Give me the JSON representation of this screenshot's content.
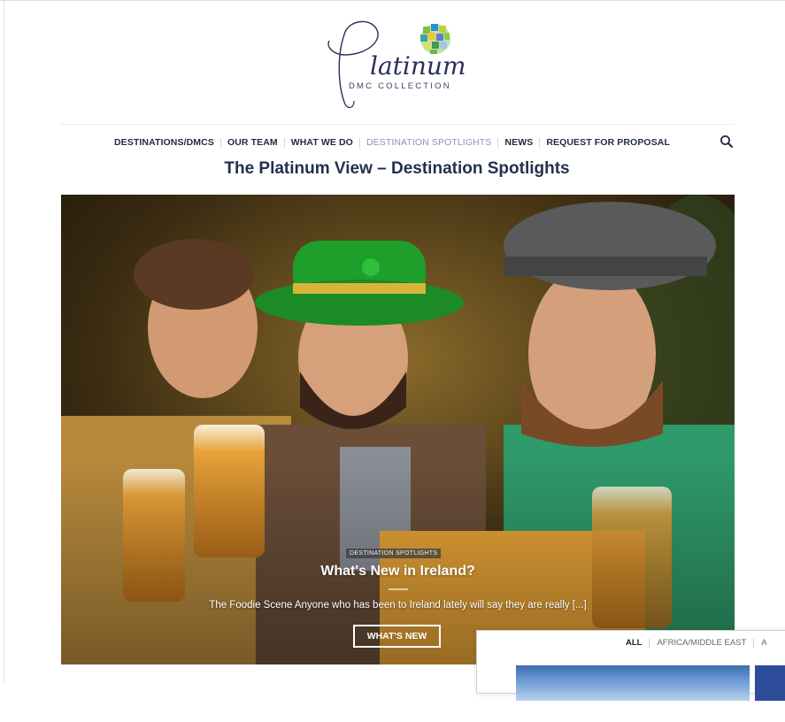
{
  "logo": {
    "name": "Platinum",
    "sub": "DMC COLLECTION"
  },
  "nav": {
    "items": [
      {
        "label": "DESTINATIONS/DMCS"
      },
      {
        "label": "OUR TEAM"
      },
      {
        "label": "WHAT WE DO"
      },
      {
        "label": "DESTINATION SPOTLIGHTS",
        "active": true
      },
      {
        "label": "NEWS"
      },
      {
        "label": "REQUEST FOR PROPOSAL"
      }
    ],
    "search_icon": "search-icon"
  },
  "page": {
    "title": "The Platinum View – Destination Spotlights"
  },
  "hero": {
    "category": "DESTINATION SPOTLIGHTS",
    "title": "What's New in Ireland?",
    "excerpt": "The Foodie Scene Anyone who has been to Ireland lately will say they are really [...]",
    "button_label": "WHAT'S NEW"
  },
  "filter": {
    "items": [
      {
        "label": "ALL",
        "active": true
      },
      {
        "label": "AFRICA/MIDDLE EAST"
      },
      {
        "label": "A"
      }
    ]
  },
  "colors": {
    "navy": "#1f2a44",
    "active_nav": "#8a96b8",
    "hat_green": "#1e9e2a"
  }
}
